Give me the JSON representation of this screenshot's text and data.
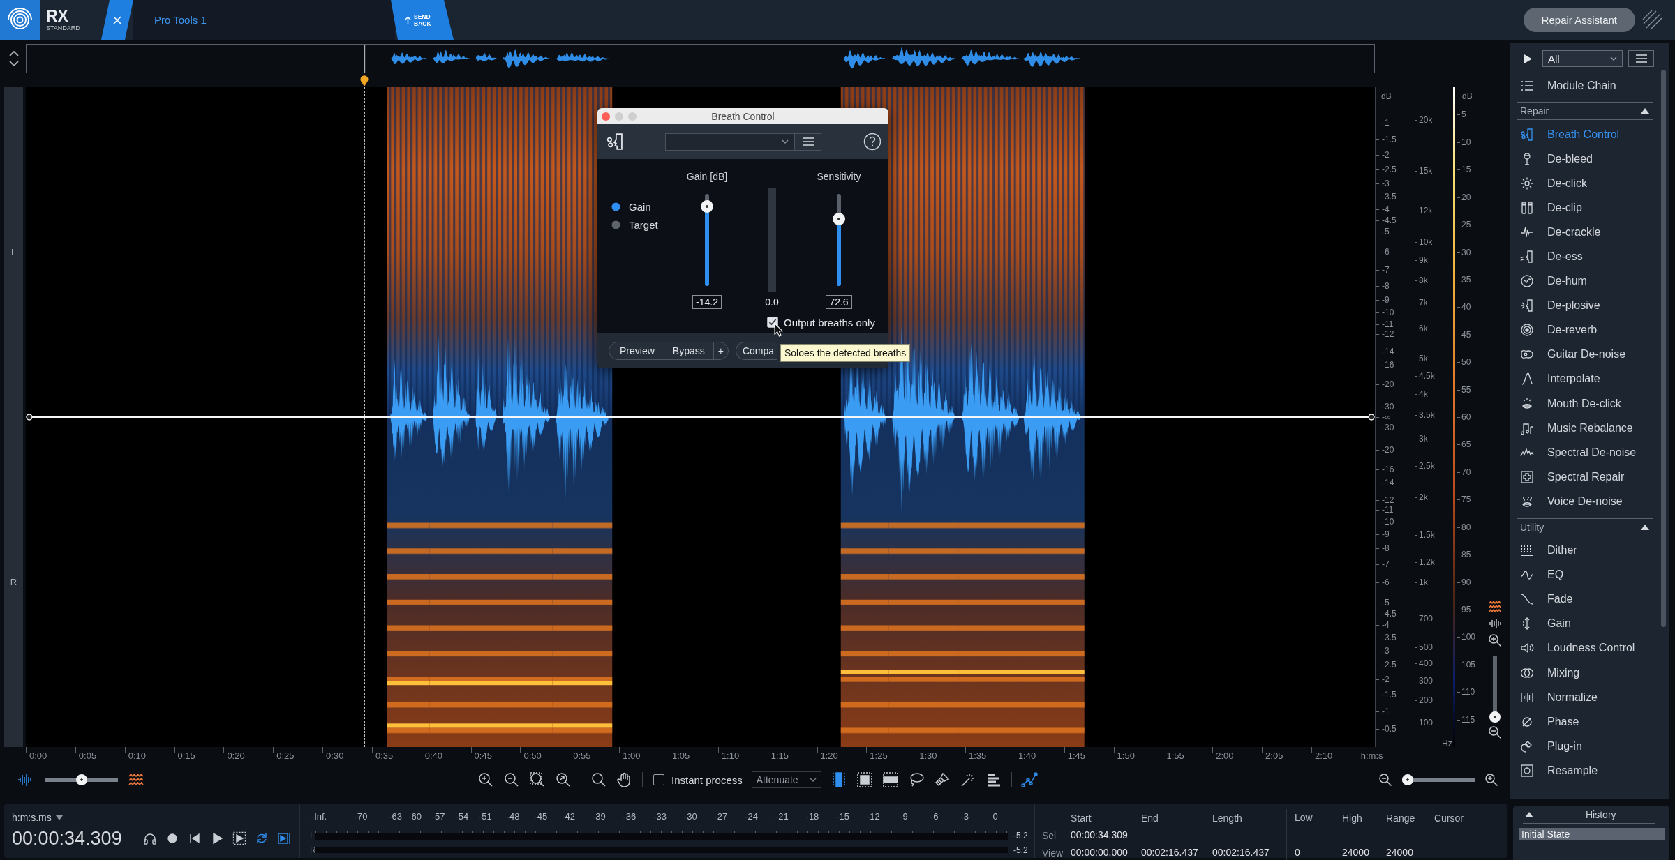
{
  "app": {
    "logo": "RX",
    "edition": "STANDARD"
  },
  "tabs": [
    {
      "label": "Pro Tools 1",
      "selected": true
    }
  ],
  "send_back": "SEND BACK",
  "repair_assistant": "Repair Assistant",
  "channels": [
    {
      "label": "L"
    },
    {
      "label": "R"
    }
  ],
  "dialog": {
    "title": "Breath Control",
    "modes": [
      {
        "label": "Gain",
        "selected": true
      },
      {
        "label": "Target",
        "selected": false
      }
    ],
    "sliders": [
      {
        "label": "Gain [dB]",
        "value": "-14.2",
        "level": 0.86
      },
      {
        "label": "Sensitivity",
        "value": "72.6",
        "level": 0.73
      }
    ],
    "meter_reading": "0.0",
    "output_breaths_only": {
      "label": "Output breaths only",
      "checked": true
    },
    "button_group": [
      "Preview",
      "Bypass",
      "+"
    ],
    "compare_button": "Compa",
    "tooltip": "Soloes the detected breaths"
  },
  "amplitude_scale": {
    "unit": "dB",
    "upper": [
      "-1",
      "-1.5",
      "-2",
      "-2.5",
      "-3",
      "-3.5",
      "-4",
      "-4.5",
      "-5",
      "-6",
      "-7",
      "-8",
      "-9",
      "-10",
      "-11",
      "-12",
      "-14",
      "-16",
      "-20",
      "-30"
    ],
    "center": "-∞",
    "lower": [
      "-30",
      "-20",
      "-16",
      "-14",
      "-12",
      "-11",
      "-10",
      "-9",
      "-8",
      "-7",
      "-6",
      "-5",
      "-4.5",
      "-4",
      "-3.5",
      "-3",
      "-2.5",
      "-2",
      "-1.5",
      "-1",
      "-0.5"
    ]
  },
  "frequency_scale": {
    "unit": "Hz",
    "ticks": [
      "20k",
      "15k",
      "12k",
      "10k",
      "9k",
      "8k",
      "7k",
      "6k",
      "5k",
      "4.5k",
      "4k",
      "3.5k",
      "3k",
      "2.5k",
      "2k",
      "1.5k",
      "1.2k",
      "1k",
      "700",
      "500",
      "400",
      "300",
      "200",
      "100"
    ]
  },
  "color_scale": {
    "unit": "dB",
    "ticks": [
      "5",
      "10",
      "15",
      "20",
      "25",
      "30",
      "35",
      "40",
      "45",
      "50",
      "55",
      "60",
      "65",
      "70",
      "75",
      "80",
      "85",
      "90",
      "95",
      "100",
      "105",
      "110",
      "115"
    ]
  },
  "vertical_zoom": {
    "level": 0
  },
  "module_panel": {
    "filter": "All",
    "chain": "Module Chain",
    "sections": [
      {
        "title": "Repair",
        "expanded": true,
        "items": [
          {
            "label": "Breath Control",
            "selected": true
          },
          {
            "label": "De-bleed",
            "selected": false
          },
          {
            "label": "De-click",
            "selected": false
          },
          {
            "label": "De-clip",
            "selected": false
          },
          {
            "label": "De-crackle",
            "selected": false
          },
          {
            "label": "De-ess",
            "selected": false
          },
          {
            "label": "De-hum",
            "selected": false
          },
          {
            "label": "De-plosive",
            "selected": false
          },
          {
            "label": "De-reverb",
            "selected": false
          },
          {
            "label": "Guitar De-noise",
            "selected": false
          },
          {
            "label": "Interpolate",
            "selected": false
          },
          {
            "label": "Mouth De-click",
            "selected": false
          },
          {
            "label": "Music Rebalance",
            "selected": false
          },
          {
            "label": "Spectral De-noise",
            "selected": false
          },
          {
            "label": "Spectral Repair",
            "selected": false
          },
          {
            "label": "Voice De-noise",
            "selected": false
          }
        ]
      },
      {
        "title": "Utility",
        "expanded": true,
        "items": [
          {
            "label": "Dither",
            "selected": false
          },
          {
            "label": "EQ",
            "selected": false
          },
          {
            "label": "Fade",
            "selected": false
          },
          {
            "label": "Gain",
            "selected": false
          },
          {
            "label": "Loudness Control",
            "selected": false
          },
          {
            "label": "Mixing",
            "selected": false
          },
          {
            "label": "Normalize",
            "selected": false
          },
          {
            "label": "Phase",
            "selected": false
          },
          {
            "label": "Plug-in",
            "selected": false
          },
          {
            "label": "Resample",
            "selected": false
          }
        ]
      }
    ]
  },
  "time_axis": {
    "ticks": [
      "0:00",
      "0:05",
      "0:10",
      "0:15",
      "0:20",
      "0:25",
      "0:30",
      "0:35",
      "0:40",
      "0:45",
      "0:50",
      "0:55",
      "1:00",
      "1:05",
      "1:10",
      "1:15",
      "1:20",
      "1:25",
      "1:30",
      "1:35",
      "1:40",
      "1:45",
      "1:50",
      "1:55",
      "2:00",
      "2:05",
      "2:10"
    ],
    "unit": "h:m:s"
  },
  "toolbar": {
    "view_blend": {
      "level": 0.5
    },
    "instant_process": {
      "label": "Instant process",
      "checked": false
    },
    "mode": "Attenuate",
    "tools": [
      {
        "selected": true
      },
      {
        "selected": false
      },
      {
        "selected": false
      },
      {
        "selected": false
      },
      {
        "selected": false
      },
      {
        "selected": false
      },
      {
        "selected": false
      },
      {
        "selected": true
      }
    ],
    "zoom": {
      "level": 0.08
    }
  },
  "transport": {
    "time_format": "h:m:s.ms",
    "time": "00:00:34.309",
    "buttons": [
      {
        "on": false
      },
      {
        "on": false
      },
      {
        "on": false
      },
      {
        "on": false
      },
      {
        "on": false
      },
      {
        "on": true
      },
      {
        "on": true
      }
    ]
  },
  "meter": {
    "ticks": [
      "-Inf.",
      "-70",
      "-63",
      "-60",
      "-57",
      "-54",
      "-51",
      "-48",
      "-45",
      "-42",
      "-39",
      "-36",
      "-33",
      "-30",
      "-27",
      "-24",
      "-21",
      "-18",
      "-15",
      "-12",
      "-9",
      "-6",
      "-3",
      "0"
    ],
    "channels": [
      {
        "label": "L",
        "reading": "-5.2"
      },
      {
        "label": "R",
        "reading": "-5.2"
      }
    ]
  },
  "selection": {
    "columns": [
      "Start",
      "End",
      "Length",
      "Low",
      "High",
      "Range",
      "Cursor"
    ],
    "rows": [
      {
        "label": "Sel",
        "cells": [
          "00:00:34.309"
        ]
      },
      {
        "label": "View",
        "cells": [
          "00:00:00.000",
          "00:02:16.437",
          "00:02:16.437",
          "0",
          "24000",
          "24000"
        ]
      }
    ]
  },
  "history": {
    "title": "History",
    "expanded": true,
    "items": [
      {
        "label": "Initial State",
        "selected": true
      }
    ]
  }
}
